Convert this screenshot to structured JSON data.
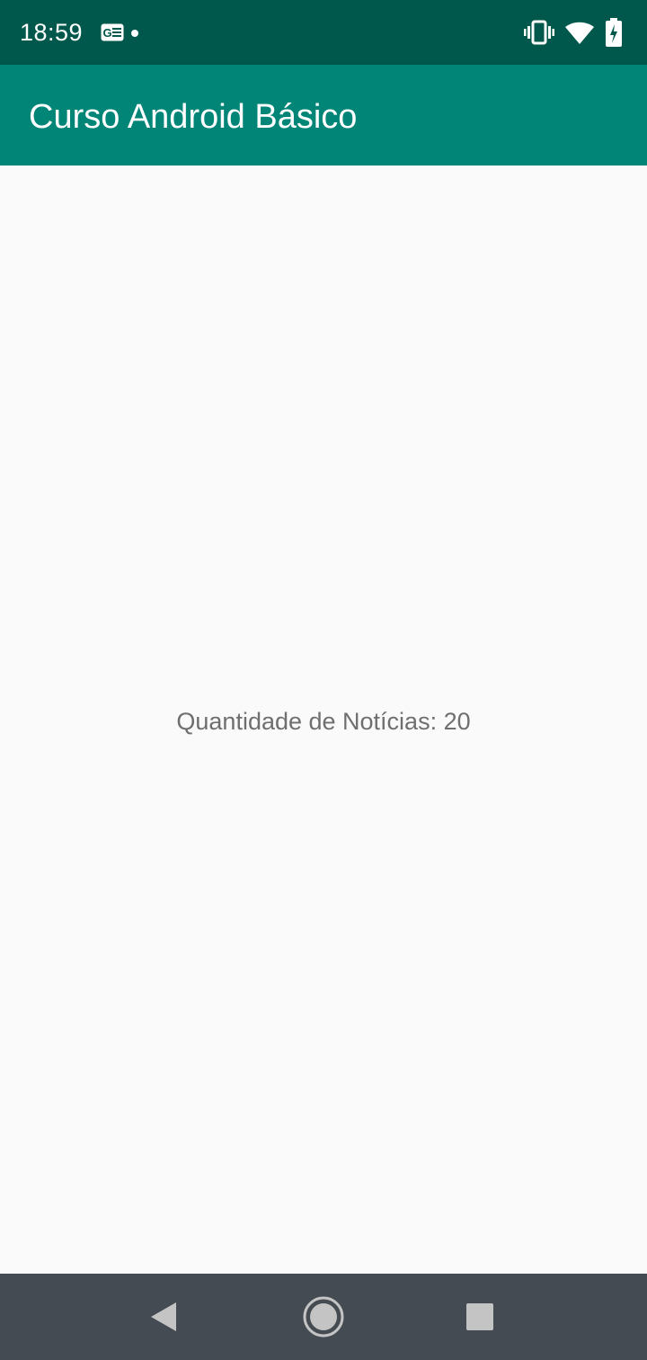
{
  "status_bar": {
    "time": "18:59",
    "icons": [
      "news-icon",
      "notification-dot-icon",
      "vibrate-icon",
      "wifi-icon",
      "battery-charging-icon"
    ]
  },
  "app_bar": {
    "title": "Curso Android Básico"
  },
  "main": {
    "news_count_text": "Quantidade de Notícias: 20"
  },
  "nav_bar": {
    "icons": [
      "back-icon",
      "home-icon",
      "recents-icon"
    ]
  },
  "colors": {
    "status_bar": "#00574b",
    "app_bar": "#008577",
    "background": "#fafafa",
    "nav_bar": "#444b52",
    "text_secondary": "#6f6f6f"
  }
}
